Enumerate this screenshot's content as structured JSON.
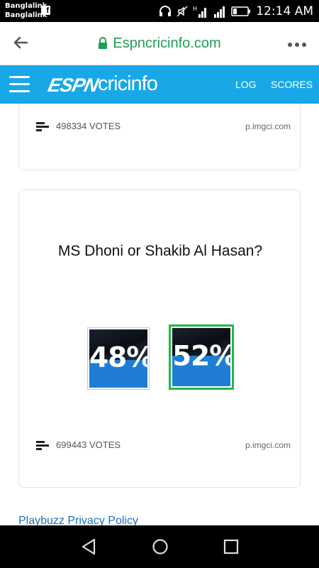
{
  "status_bar": {
    "carrier_1": "Banglalink",
    "carrier_2": "Banglalink",
    "time": "12:14 AM"
  },
  "url_bar": {
    "url": "Espncricinfo.com"
  },
  "header": {
    "logo_espn": "ESPN",
    "logo_cricinfo": "cricinfo",
    "nav_log": "LOG",
    "nav_scores": "SCORES"
  },
  "poll_1": {
    "votes": "498334 VOTES",
    "source": "p.imgci.com"
  },
  "poll_2": {
    "question": "MS Dhoni or Shakib Al Hasan?",
    "options": [
      {
        "percent_label": "48%",
        "fraction": 0.48,
        "selected": false
      },
      {
        "percent_label": "52%",
        "fraction": 0.52,
        "selected": true
      }
    ],
    "votes": "699443 VOTES",
    "source": "p.imgci.com"
  },
  "footer_link": "Playbuzz Privacy Policy",
  "colors": {
    "header_blue": "#18a8e8",
    "url_green": "#1f9d55",
    "selected_border": "#1fba44",
    "fill_blue": "#1f7ed3",
    "link_blue": "#1c6fbf"
  },
  "icons": [
    "facebook-icon",
    "headphones-icon",
    "mute-icon",
    "signal-icon",
    "battery-icon",
    "back-arrow-icon",
    "lock-icon",
    "more-icon",
    "menu-icon",
    "bars-chart-icon",
    "nav-back-icon",
    "nav-home-icon",
    "nav-recents-icon"
  ]
}
